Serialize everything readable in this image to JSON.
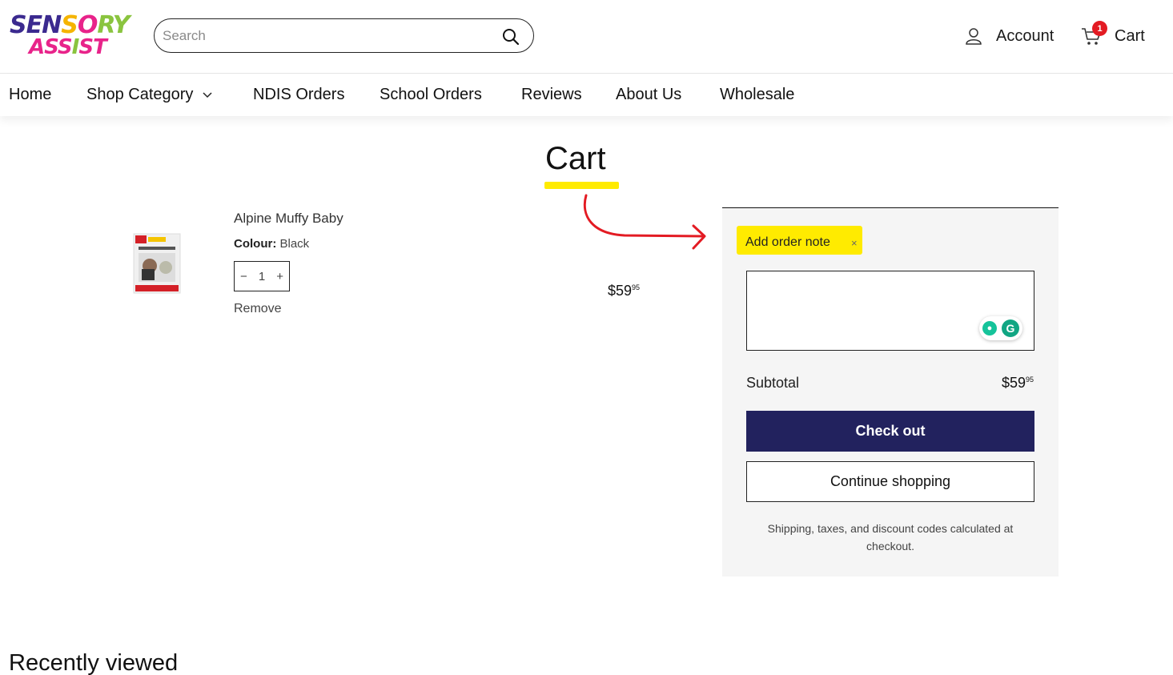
{
  "header": {
    "logo": {
      "line1": "SENSORY",
      "line2": "ASSIST"
    },
    "search": {
      "placeholder": "Search",
      "icon": "search-icon"
    },
    "account": {
      "label": "Account",
      "icon": "user-icon"
    },
    "cart": {
      "label": "Cart",
      "badge_count": "1",
      "icon": "cart-icon"
    }
  },
  "nav": {
    "items": [
      {
        "label": "Home"
      },
      {
        "label": "Shop Category",
        "has_dropdown": true
      },
      {
        "label": "NDIS Orders"
      },
      {
        "label": "School Orders"
      },
      {
        "label": "Reviews"
      },
      {
        "label": "About Us"
      },
      {
        "label": "Wholesale"
      }
    ]
  },
  "page": {
    "title": "Cart",
    "annotation_colors": {
      "highlight": "#ffeb00",
      "arrow": "#e31b23"
    }
  },
  "cart_item": {
    "name": "Alpine Muffy Baby",
    "colour_label": "Colour:",
    "colour_value": "Black",
    "qty_minus": "−",
    "quantity": "1",
    "qty_plus": "+",
    "remove_label": "Remove",
    "price_main": "$59",
    "price_cents": "95"
  },
  "summary": {
    "order_note_label": "Add order note",
    "order_note_close": "×",
    "subtotal_label": "Subtotal",
    "subtotal_main": "$59",
    "subtotal_cents": "95",
    "checkout_label": "Check out",
    "continue_label": "Continue shopping",
    "shipping_note": "Shipping, taxes, and discount codes calculated at checkout.",
    "grammarly_icon_letter": "G"
  },
  "recently_viewed": {
    "title": "Recently viewed"
  },
  "colors": {
    "checkout_bg": "#22225e",
    "badge": "#e31b23",
    "summary_bg": "#f5f5f5"
  }
}
